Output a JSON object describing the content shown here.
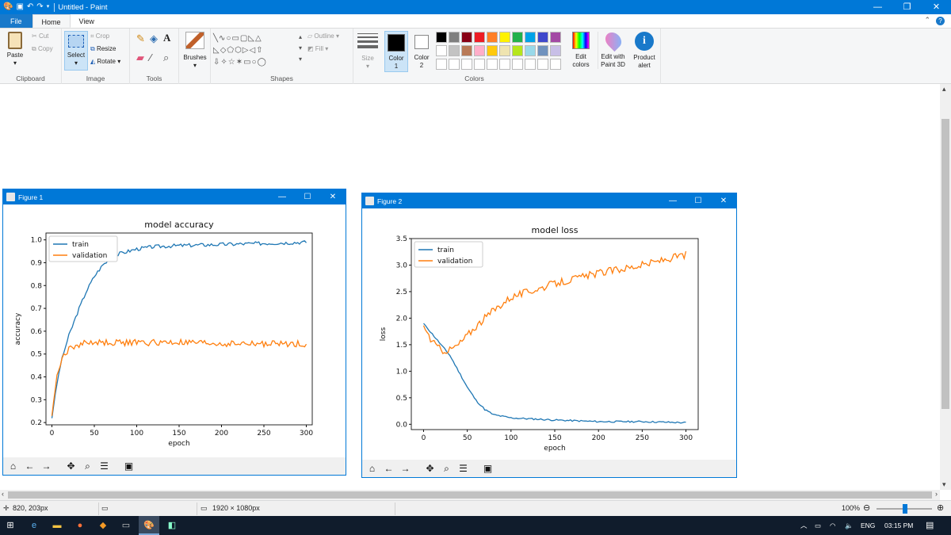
{
  "titlebar": {
    "title": "Untitled - Paint",
    "quick_access": [
      "paint-app-icon",
      "save-icon",
      "undo-icon",
      "redo-icon",
      "customize-icon"
    ],
    "minimize": "—",
    "restore": "❐",
    "close": "✕"
  },
  "tabs": [
    {
      "label": "File",
      "state": "file"
    },
    {
      "label": "Home",
      "state": "active"
    },
    {
      "label": "View",
      "state": "normal"
    }
  ],
  "ribbon": {
    "clipboard": {
      "paste": "Paste",
      "cut": "Cut",
      "copy": "Copy",
      "label": "Clipboard"
    },
    "image": {
      "select": "Select",
      "crop": "Crop",
      "resize": "Resize",
      "rotate": "Rotate",
      "label": "Image"
    },
    "tools": {
      "label": "Tools"
    },
    "brushes": {
      "label": "Brushes"
    },
    "shapes": {
      "outline": "Outline",
      "fill": "Fill",
      "label": "Shapes"
    },
    "size": {
      "label": "Size"
    },
    "colors": {
      "color1_line1": "Color",
      "color1_line2": "1",
      "color2_line1": "Color",
      "color2_line2": "2",
      "edit_line1": "Edit",
      "edit_line2": "colors",
      "paint3d_line1": "Edit with",
      "paint3d_line2": "Paint 3D",
      "alert_line1": "Product",
      "alert_line2": "alert",
      "label": "Colors",
      "color1": "#000000",
      "color2": "#ffffff",
      "palette_row1": [
        "#000000",
        "#7f7f7f",
        "#880015",
        "#ed1c24",
        "#ff7f27",
        "#fff200",
        "#22b14c",
        "#00a2e8",
        "#3f48cc",
        "#a349a4"
      ],
      "palette_row2": [
        "#ffffff",
        "#c3c3c3",
        "#b97a57",
        "#ffaec9",
        "#ffc90e",
        "#efe4b0",
        "#b5e61d",
        "#99d9ea",
        "#7092be",
        "#c8bfe7"
      ]
    }
  },
  "figure1": {
    "title": "Figure 1",
    "chart_title": "model accuracy",
    "ylabel": "accuracy",
    "xlabel": "epoch",
    "legend": [
      "train",
      "validation"
    ]
  },
  "figure2": {
    "title": "Figure 2",
    "chart_title": "model loss",
    "ylabel": "loss",
    "xlabel": "epoch",
    "legend": [
      "train",
      "validation"
    ]
  },
  "chart_data": [
    {
      "type": "line",
      "title": "model accuracy",
      "xlabel": "epoch",
      "ylabel": "accuracy",
      "xlim": [
        -7,
        307
      ],
      "ylim": [
        0.19,
        1.03
      ],
      "xticks": [
        0,
        50,
        100,
        150,
        200,
        250,
        300
      ],
      "yticks": [
        0.2,
        0.3,
        0.4,
        0.5,
        0.6,
        0.7,
        0.8,
        0.9,
        1.0
      ],
      "legend_position": "upper-left",
      "series": [
        {
          "name": "train",
          "color": "#1f77b4",
          "x": [
            0,
            5,
            10,
            15,
            20,
            30,
            40,
            50,
            60,
            70,
            80,
            100,
            120,
            150,
            200,
            250,
            300
          ],
          "y": [
            0.22,
            0.35,
            0.45,
            0.52,
            0.58,
            0.68,
            0.77,
            0.84,
            0.89,
            0.92,
            0.94,
            0.96,
            0.97,
            0.975,
            0.98,
            0.985,
            0.99
          ]
        },
        {
          "name": "validation",
          "color": "#ff7f0e",
          "x": [
            0,
            5,
            10,
            15,
            20,
            30,
            40,
            50,
            75,
            100,
            150,
            200,
            250,
            300
          ],
          "y": [
            0.23,
            0.38,
            0.46,
            0.5,
            0.52,
            0.54,
            0.55,
            0.55,
            0.55,
            0.55,
            0.55,
            0.545,
            0.545,
            0.545
          ]
        }
      ]
    },
    {
      "type": "line",
      "title": "model loss",
      "xlabel": "epoch",
      "ylabel": "loss",
      "xlim": [
        -14,
        314
      ],
      "ylim": [
        -0.1,
        3.5
      ],
      "xticks": [
        0,
        50,
        100,
        150,
        200,
        250,
        300
      ],
      "yticks": [
        0.0,
        0.5,
        1.0,
        1.5,
        2.0,
        2.5,
        3.0,
        3.5
      ],
      "legend_position": "upper-left",
      "series": [
        {
          "name": "train",
          "color": "#1f77b4",
          "x": [
            0,
            10,
            20,
            30,
            40,
            50,
            60,
            70,
            80,
            100,
            150,
            200,
            250,
            300
          ],
          "y": [
            1.9,
            1.7,
            1.5,
            1.3,
            1.0,
            0.7,
            0.45,
            0.28,
            0.18,
            0.12,
            0.08,
            0.05,
            0.05,
            0.03
          ]
        },
        {
          "name": "validation",
          "color": "#ff7f0e",
          "x": [
            0,
            10,
            20,
            30,
            40,
            60,
            80,
            100,
            150,
            200,
            250,
            300
          ],
          "y": [
            1.85,
            1.55,
            1.4,
            1.4,
            1.5,
            1.85,
            2.15,
            2.4,
            2.65,
            2.85,
            3.0,
            3.2
          ]
        }
      ]
    }
  ],
  "status": {
    "cursor_pos": "820, 203px",
    "selection_size": "",
    "image_size": "1920 × 1080px",
    "zoom": "100%"
  },
  "taskbar": {
    "apps": [
      "start-icon",
      "edge-icon",
      "explorer-icon",
      "firefox-icon",
      "sublime-icon",
      "terminal-icon",
      "paint-icon",
      "python-icon"
    ],
    "language": "ENG",
    "time": "03:15 PM"
  }
}
